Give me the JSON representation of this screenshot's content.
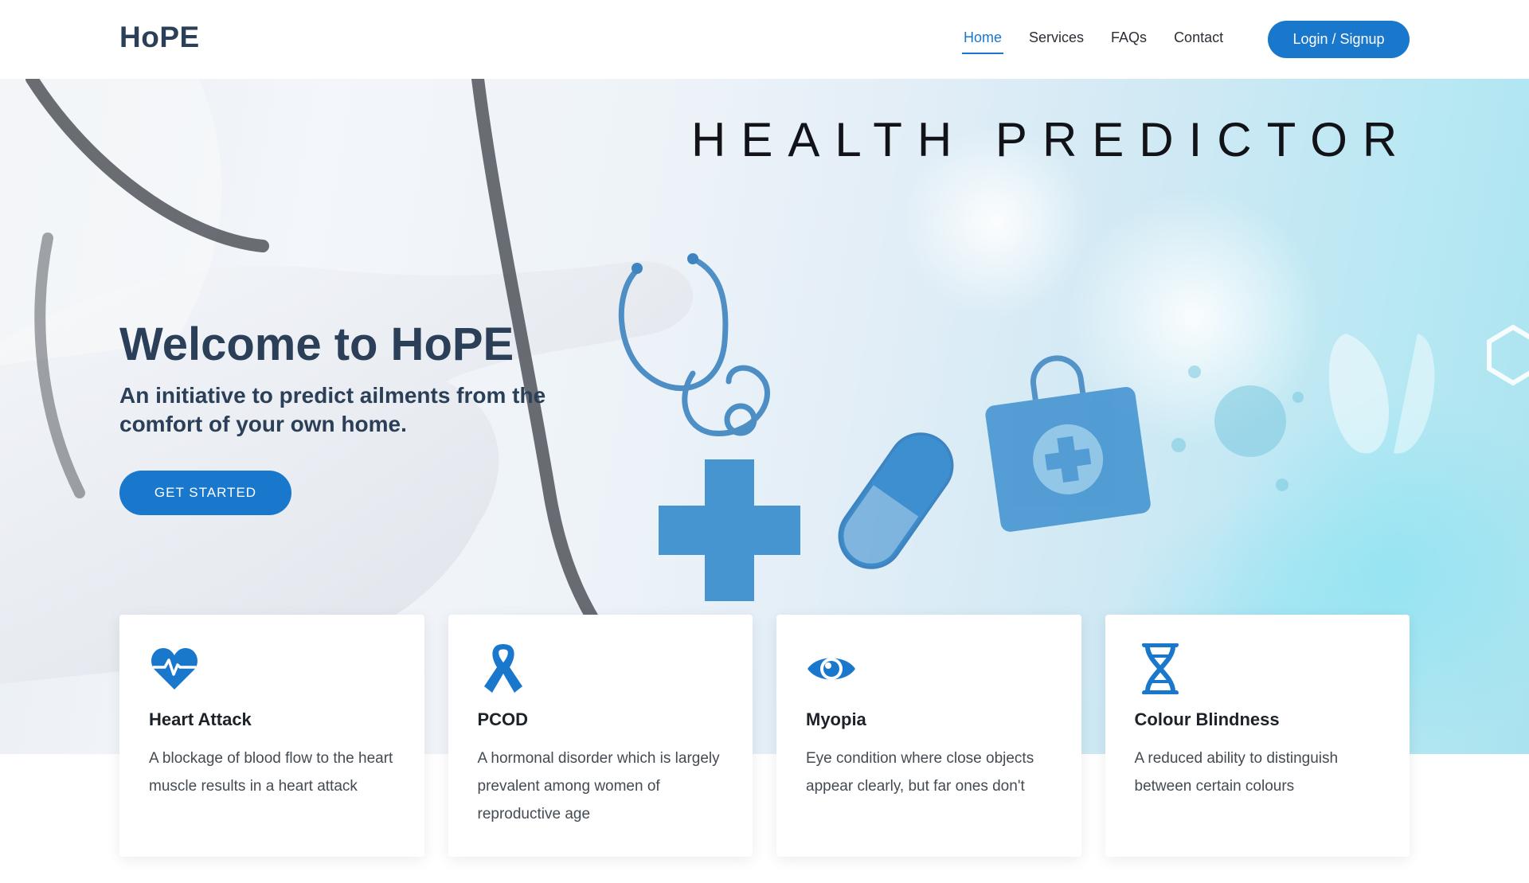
{
  "header": {
    "logo": "HoPE",
    "nav": [
      {
        "label": "Home",
        "active": true
      },
      {
        "label": "Services",
        "active": false
      },
      {
        "label": "FAQs",
        "active": false
      },
      {
        "label": "Contact",
        "active": false
      }
    ],
    "login_label": "Login / Signup"
  },
  "hero": {
    "title": "HEALTH PREDICTOR",
    "welcome": "Welcome to HoPE",
    "subtitle": "An initiative to predict ailments from the comfort of your own home.",
    "cta_label": "GET STARTED"
  },
  "cards": [
    {
      "icon": "heart-pulse-icon",
      "title": "Heart Attack",
      "description": "A blockage of blood flow to the heart muscle results in a heart attack"
    },
    {
      "icon": "ribbon-icon",
      "title": "PCOD",
      "description": "A hormonal disorder which is largely prevalent among women of reproductive age"
    },
    {
      "icon": "eye-icon",
      "title": "Myopia",
      "description": "Eye condition where close objects appear clearly, but far ones don't"
    },
    {
      "icon": "dna-icon",
      "title": "Colour Blindness",
      "description": "A reduced ability to distinguish between certain colours"
    }
  ],
  "colors": {
    "accent": "#1977cc",
    "heading": "#2b4058"
  }
}
